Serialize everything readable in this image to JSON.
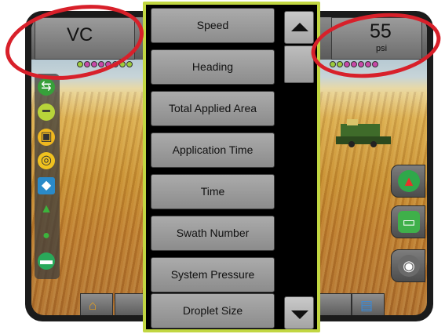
{
  "screen": {
    "left_readout": {
      "value": "VC"
    },
    "right_readout": {
      "value": "55",
      "unit": "psi"
    }
  },
  "dropdown": {
    "items": [
      {
        "label": "Speed"
      },
      {
        "label": "Heading"
      },
      {
        "label": "Total Applied Area"
      },
      {
        "label": "Application Time"
      },
      {
        "label": "Time"
      },
      {
        "label": "Swath Number"
      },
      {
        "label": "System Pressure"
      },
      {
        "label": "Droplet Size"
      }
    ],
    "scroll_up_icon": "triangle-up-icon",
    "scroll_down_icon": "triangle-down-icon"
  },
  "icons": {
    "left_toolbar": [
      "guidance-mode-icon",
      "boom-icon",
      "alert-icon",
      "gps-icon",
      "marker-icon",
      "vehicle-icon",
      "drop-icon",
      "rate-icon"
    ],
    "right_buttons": [
      "nav-arrow-icon",
      "chat-icon",
      "camera-icon"
    ],
    "bottom_tabs": [
      "home-icon",
      "screens-icon"
    ]
  },
  "colors": {
    "highlight_ring": "#d8202a",
    "dropdown_border": "#c1d641",
    "boom_section_active": "#9ccc3c",
    "boom_section_off": "#c848a8"
  }
}
